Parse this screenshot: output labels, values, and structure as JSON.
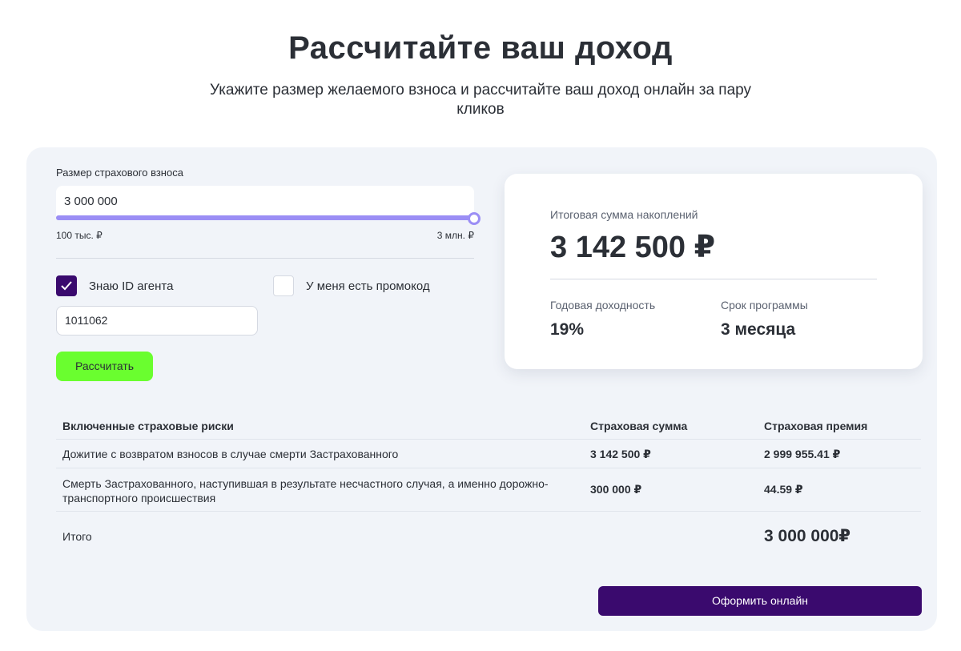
{
  "header": {
    "title": "Рассчитайте ваш доход",
    "subtitle": "Укажите размер желаемого взноса и рассчитайте ваш доход онлайн за пару кликов"
  },
  "calculator": {
    "contribution_label": "Размер страхового взноса",
    "contribution_value": "3 000 000",
    "slider": {
      "min_label": "100 тыс. ₽",
      "max_label": "3 млн. ₽",
      "min": 100000,
      "max": 3000000,
      "value": 3000000
    },
    "agent_checkbox": {
      "label": "Знаю ID агента",
      "checked": true
    },
    "promo_checkbox": {
      "label": "У меня есть промокод",
      "checked": false
    },
    "agent_id_value": "1011062",
    "calculate_label": "Рассчитать"
  },
  "result": {
    "total_label": "Итоговая сумма накоплений",
    "total_value": "3 142 500 ₽",
    "yield_label": "Годовая доходность",
    "yield_value": "19%",
    "term_label": "Срок программы",
    "term_value": "3 месяца"
  },
  "risks": {
    "headers": [
      "Включенные страховые риски",
      "Страховая сумма",
      "Страховая премия"
    ],
    "rows": [
      {
        "risk": "Дожитие с возвратом взносов в случае смерти Застрахованного",
        "sum": "3 142 500 ₽",
        "premium": "2 999 955.41 ₽"
      },
      {
        "risk": "Смерть Застрахованного, наступившая в результате несчастного случая, а именно дорожно-транспортного происшествия",
        "sum": "300 000 ₽",
        "premium": "44.59 ₽"
      }
    ],
    "total_label": "Итого",
    "total_value": "3 000 000₽"
  },
  "apply_label": "Оформить онлайн",
  "colors": {
    "accent_dark": "#3a0a6e",
    "accent_green": "#6afe2f",
    "slider": "#9b8ef5",
    "card_bg": "#f1f4f9"
  },
  "icons": {
    "checkmark": "check-icon"
  }
}
